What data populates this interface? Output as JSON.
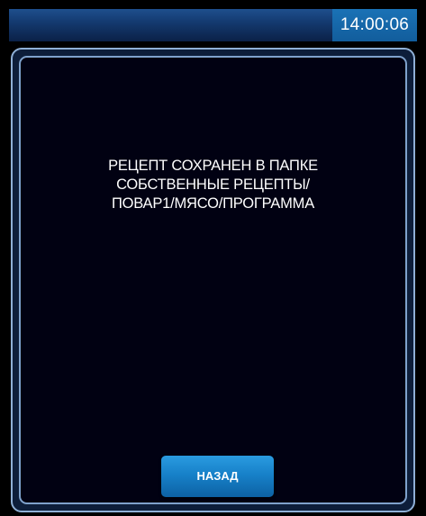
{
  "header": {
    "clock": "14:00:06"
  },
  "dialog": {
    "message_lines": [
      "РЕЦЕПТ СОХРАНЕН В ПАПКЕ",
      "СОБСТВЕННЫЕ РЕЦЕПТЫ/",
      "ПОВАР1/МЯСО/ПРОГРАММА"
    ],
    "back_button_label": "НАЗАД"
  },
  "colors": {
    "background": "#000000",
    "header": "#143a70",
    "clock_bg": "#1a72b6",
    "panel_border": "#8fb0d6",
    "panel_bg": "#010112",
    "button": "#1781c9",
    "text": "#ffffff"
  }
}
